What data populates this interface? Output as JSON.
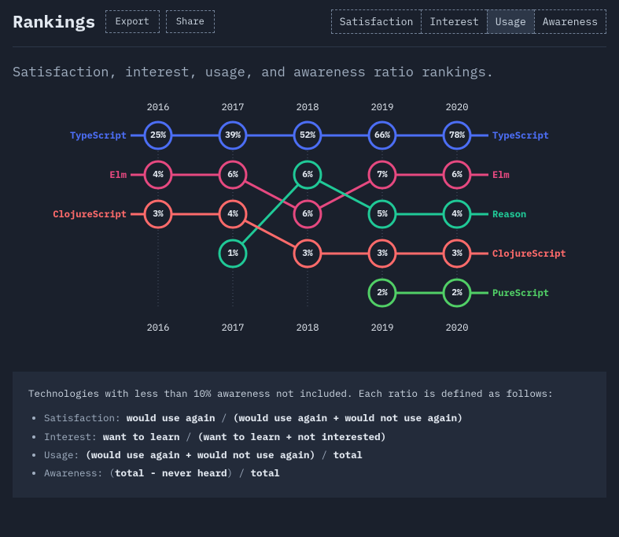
{
  "header": {
    "title": "Rankings",
    "export": "Export",
    "share": "Share"
  },
  "tabs": {
    "satisfaction": "Satisfaction",
    "interest": "Interest",
    "usage": "Usage",
    "awareness": "Awareness",
    "active": "usage"
  },
  "subtitle": "Satisfaction, interest, usage, and awareness ratio rankings.",
  "years": [
    "2016",
    "2017",
    "2018",
    "2019",
    "2020"
  ],
  "series_left": [
    "TypeScript",
    "Elm",
    "ClojureScript"
  ],
  "series_right": [
    "TypeScript",
    "Elm",
    "Reason",
    "ClojureScript",
    "PureScript"
  ],
  "colors": {
    "TypeScript": "#4c6ef5",
    "Elm": "#e64980",
    "ClojureScript": "#ff6b6b",
    "Reason": "#20c997",
    "PureScript": "#51cf66"
  },
  "chart_data": {
    "type": "line",
    "title": "Rankings — Usage",
    "xlabel": "",
    "ylabel": "rank",
    "categories": [
      "2016",
      "2017",
      "2018",
      "2019",
      "2020"
    ],
    "series": [
      {
        "name": "TypeScript",
        "rank": [
          1,
          1,
          1,
          1,
          1
        ],
        "values": [
          "25%",
          "39%",
          "52%",
          "66%",
          "78%"
        ],
        "color": "#4c6ef5"
      },
      {
        "name": "Elm",
        "rank": [
          2,
          2,
          3,
          2,
          2
        ],
        "values": [
          "4%",
          "6%",
          "6%",
          "7%",
          "6%"
        ],
        "color": "#e64980"
      },
      {
        "name": "Reason",
        "rank": [
          null,
          4,
          2,
          3,
          3
        ],
        "values": [
          null,
          "1%",
          "6%",
          "5%",
          "4%"
        ],
        "color": "#20c997"
      },
      {
        "name": "ClojureScript",
        "rank": [
          3,
          3,
          4,
          4,
          4
        ],
        "values": [
          "3%",
          "4%",
          "3%",
          "3%",
          "3%"
        ],
        "color": "#ff6b6b"
      },
      {
        "name": "PureScript",
        "rank": [
          null,
          null,
          null,
          5,
          5
        ],
        "values": [
          null,
          null,
          null,
          "2%",
          "2%"
        ],
        "color": "#51cf66"
      }
    ],
    "ylim": [
      1,
      5
    ]
  },
  "footer": {
    "intro": "Technologies with less than 10% awareness not included. Each ratio is defined as follows:",
    "items": [
      {
        "label": "Satisfaction",
        "text1": "would use again",
        "text2": "(would use again + would not use again)"
      },
      {
        "label": "Interest",
        "text1": "want to learn",
        "text2": "(want to learn + not interested)"
      },
      {
        "label": "Usage",
        "text1": "(would use again + would not use again)",
        "text2": "total"
      },
      {
        "label": "Awareness",
        "text1": "total - never heard",
        "text2": "total"
      }
    ]
  }
}
